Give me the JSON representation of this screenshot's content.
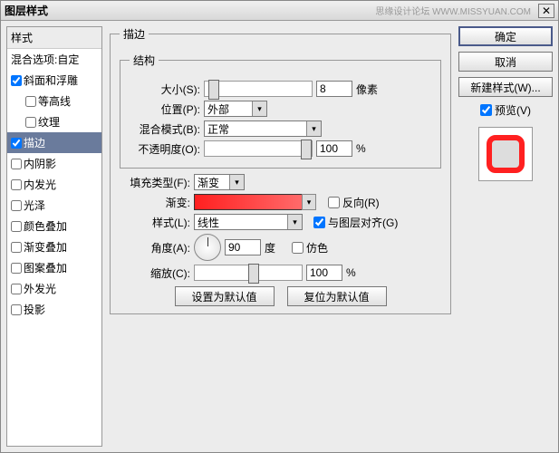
{
  "title": "图层样式",
  "watermark": "思缘设计论坛 WWW.MISSYUAN.COM",
  "sidebar": {
    "header": "样式",
    "blend": "混合选项:自定",
    "items": [
      {
        "label": "斜面和浮雕",
        "checked": true,
        "sub": false
      },
      {
        "label": "等高线",
        "checked": false,
        "sub": true
      },
      {
        "label": "纹理",
        "checked": false,
        "sub": true
      },
      {
        "label": "描边",
        "checked": true,
        "sub": false,
        "selected": true
      },
      {
        "label": "内阴影",
        "checked": false,
        "sub": false
      },
      {
        "label": "内发光",
        "checked": false,
        "sub": false
      },
      {
        "label": "光泽",
        "checked": false,
        "sub": false
      },
      {
        "label": "颜色叠加",
        "checked": false,
        "sub": false
      },
      {
        "label": "渐变叠加",
        "checked": false,
        "sub": false
      },
      {
        "label": "图案叠加",
        "checked": false,
        "sub": false
      },
      {
        "label": "外发光",
        "checked": false,
        "sub": false
      },
      {
        "label": "投影",
        "checked": false,
        "sub": false
      }
    ]
  },
  "main": {
    "group_stroke": "描边",
    "group_struct": "结构",
    "size_label": "大小(S):",
    "size_value": "8",
    "size_unit": "像素",
    "pos_label": "位置(P):",
    "pos_value": "外部",
    "blend_label": "混合模式(B):",
    "blend_value": "正常",
    "opacity_label": "不透明度(O):",
    "opacity_value": "100",
    "pct": "%",
    "fill_label": "填充类型(F):",
    "fill_value": "渐变",
    "grad_label": "渐变:",
    "reverse_label": "反向(R)",
    "style_label": "样式(L):",
    "style_value": "线性",
    "align_label": "与图层对齐(G)",
    "angle_label": "角度(A):",
    "angle_value": "90",
    "angle_unit": "度",
    "dither_label": "仿色",
    "scale_label": "缩放(C):",
    "scale_value": "100",
    "btn_default": "设置为默认值",
    "btn_reset": "复位为默认值"
  },
  "right": {
    "ok": "确定",
    "cancel": "取消",
    "newstyle": "新建样式(W)...",
    "preview_label": "预览(V)"
  }
}
